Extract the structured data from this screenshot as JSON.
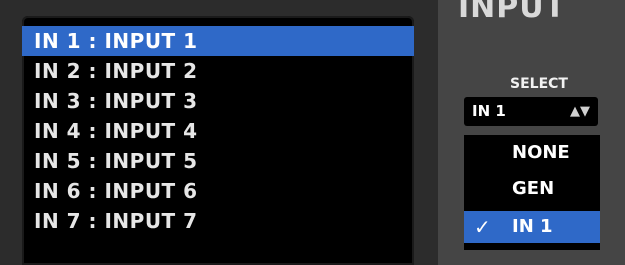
{
  "inputs_list": {
    "items": [
      {
        "label": "IN 1 : INPUT 1",
        "selected": true
      },
      {
        "label": "IN 2 : INPUT 2",
        "selected": false
      },
      {
        "label": "IN 3 : INPUT 3",
        "selected": false
      },
      {
        "label": "IN 4 : INPUT 4",
        "selected": false
      },
      {
        "label": "IN 5 : INPUT 5",
        "selected": false
      },
      {
        "label": "IN 6 : INPUT 6",
        "selected": false
      },
      {
        "label": "IN 7 : INPUT 7",
        "selected": false
      }
    ]
  },
  "input_panel": {
    "title": "INPUT",
    "select_label": "SELECT",
    "select_value": "IN 1",
    "options": [
      {
        "label": "NONE",
        "checked": false
      },
      {
        "label": "GEN",
        "checked": false
      },
      {
        "label": "IN 1",
        "checked": true
      }
    ]
  },
  "colors": {
    "selection": "#2f69c8",
    "list_background": "#000000",
    "panel_background": "#454545"
  },
  "icons": {
    "select_arrows": "updown-arrows-icon",
    "check": "checkmark-icon"
  }
}
